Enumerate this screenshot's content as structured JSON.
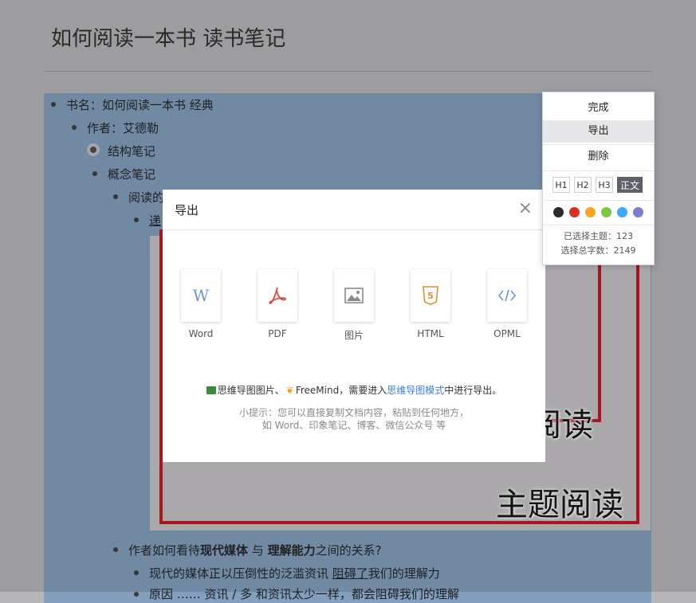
{
  "doc": {
    "title": "如何阅读一本书 读书笔记"
  },
  "outline": [
    {
      "text": "书名：如何阅读一本书 经典"
    },
    {
      "text": "作者：艾德勒"
    },
    {
      "text": "结构笔记"
    },
    {
      "text": "概念笔记"
    },
    {
      "text": "阅读的"
    },
    {
      "text": "递"
    }
  ],
  "image_text": {
    "line1": "阅读",
    "line2": "主题阅读"
  },
  "bottom_lines": {
    "l1_a": "作者如何看待",
    "l1_b": "现代媒体",
    "l1_c": " 与 ",
    "l1_d": "理解能力",
    "l1_e": "之间的关系?",
    "l2_a": "现代的媒体正以压倒性的泛滥资讯 ",
    "l2_b": "阻碍了",
    "l2_c": "我们的理解力",
    "l3": "原因 …… 资讯 / 多 和资讯太少一样，都会阻碍我们的理解"
  },
  "modal": {
    "title": "导出",
    "close": "×",
    "items": [
      {
        "label": "Word",
        "icon": "word-icon"
      },
      {
        "label": "PDF",
        "icon": "pdf-icon"
      },
      {
        "label": "图片",
        "icon": "image-icon"
      },
      {
        "label": "HTML",
        "icon": "html5-icon"
      },
      {
        "label": "OPML",
        "icon": "code-icon"
      }
    ],
    "note_a": "思维导图图片、",
    "note_b": "FreeMind，需要进入",
    "note_link": "思维导图模式",
    "note_c": "中进行导出。",
    "tip1": "小提示：您可以直接复制文档内容，粘贴到任何地方，",
    "tip2": "如 Word、印象笔记、博客、微信公众号 等"
  },
  "menu": {
    "done": "完成",
    "export": "导出",
    "delete": "删除",
    "headings": [
      "H1",
      "H2",
      "H3",
      "正文"
    ],
    "colors": [
      "#2b2b2b",
      "#d9301f",
      "#f5a623",
      "#7ac943",
      "#3ea8f5",
      "#7a80c8"
    ],
    "selected_topics_label": "已选择主题：",
    "selected_topics_value": "123",
    "total_chars_label": "选择总字数：",
    "total_chars_value": "2149"
  }
}
